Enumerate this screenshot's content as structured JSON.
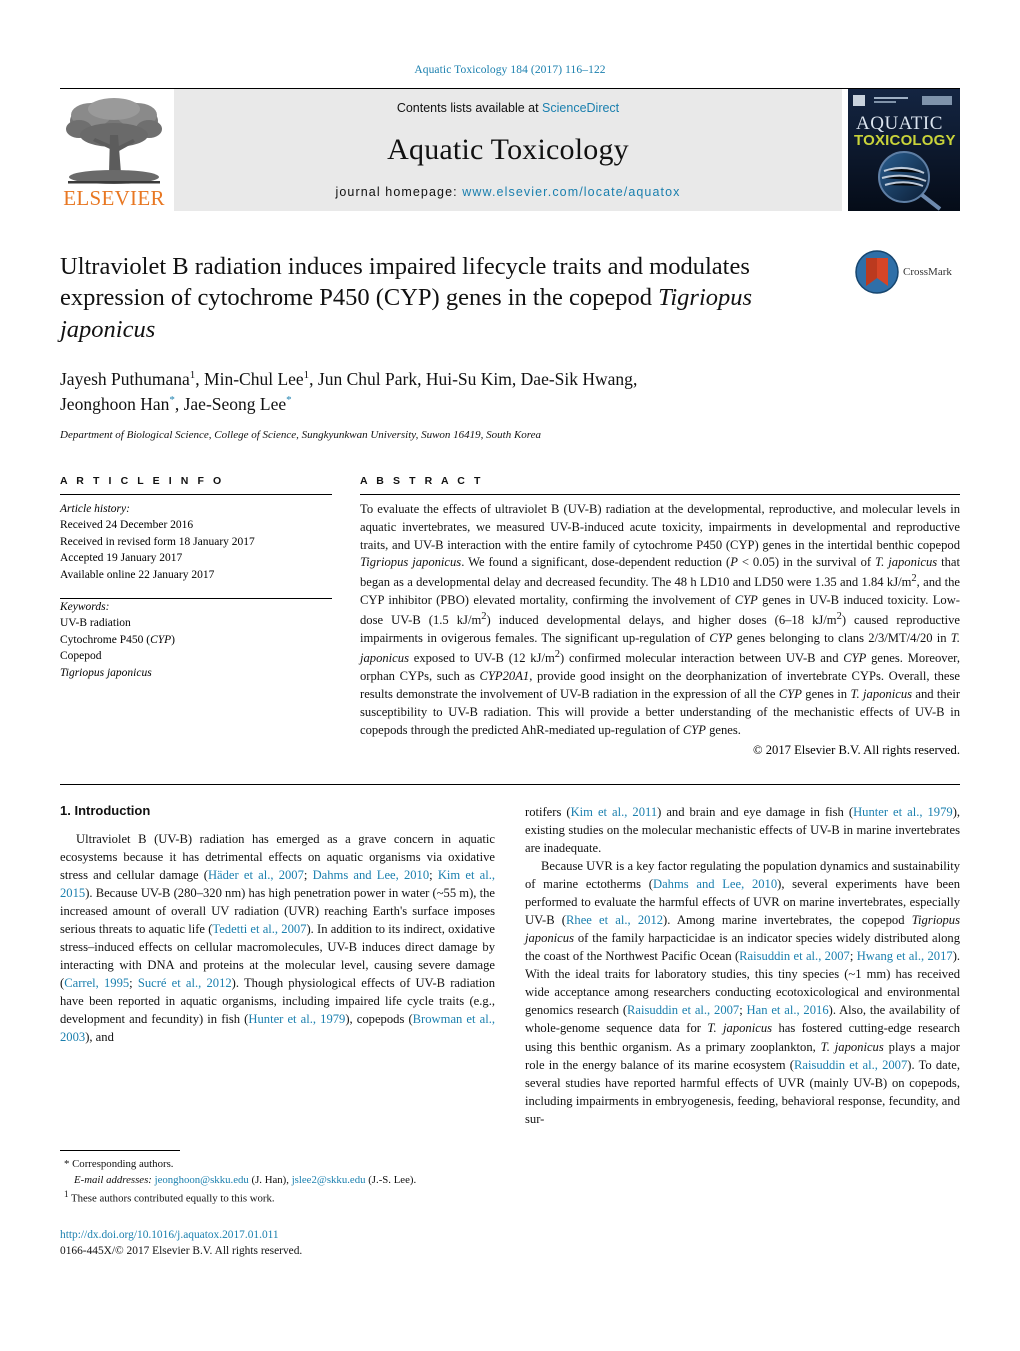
{
  "running_head": "Aquatic Toxicology 184 (2017) 116–122",
  "masthead": {
    "contents_prefix": "Contents lists available at ",
    "sciencedirect": "ScienceDirect",
    "journal_name": "Aquatic Toxicology",
    "homepage_prefix": "journal homepage: ",
    "homepage_url": "www.elsevier.com/locate/aquatox",
    "elsevier_wordmark": "ELSEVIER",
    "cover_line1": "AQUATIC",
    "cover_line2": "TOXICOLOGY",
    "accent_blue": "#1a7fae",
    "elsevier_orange": "#E87722"
  },
  "article": {
    "title_part1": "Ultraviolet B radiation induces impaired lifecycle traits and modulates expression of cytochrome P450 (CYP) genes in the copepod ",
    "title_italic": "Tigriopus japonicus",
    "crossmark_label": "CrossMark",
    "authors": "Jayesh Puthumana, Min-Chul Lee, Jun Chul Park, Hui-Su Kim, Dae-Sik Hwang, Jeonghoon Han, Jae-Seong Lee",
    "affiliation": "Department of Biological Science, College of Science, Sungkyunkwan University, Suwon 16419, South Korea"
  },
  "sections": {
    "article_info_heading": "A R T I C L E   I N F O",
    "abstract_heading": "A B S T R A C T"
  },
  "article_history": {
    "label": "Article history:",
    "lines": [
      "Received 24 December 2016",
      "Received in revised form 18 January 2017",
      "Accepted 19 January 2017",
      "Available online 22 January 2017"
    ]
  },
  "keywords": {
    "label": "Keywords:",
    "items": [
      "UV-B radiation",
      "Cytochrome P450 (CYP)",
      "Copepod",
      "Tigriopus japonicus"
    ]
  },
  "abstract": {
    "text": "To evaluate the effects of ultraviolet B (UV-B) radiation at the developmental, reproductive, and molecular levels in aquatic invertebrates, we measured UV-B-induced acute toxicity, impairments in developmental and reproductive traits, and UV-B interaction with the entire family of cytochrome P450 (CYP) genes in the intertidal benthic copepod Tigriopus japonicus. We found a significant, dose-dependent reduction (P < 0.05) in the survival of T. japonicus that began as a developmental delay and decreased fecundity. The 48 h LD10 and LD50 were 1.35 and 1.84 kJ/m2, and the CYP inhibitor (PBO) elevated mortality, confirming the involvement of CYP genes in UV-B induced toxicity. Low-dose UV-B (1.5 kJ/m2) induced developmental delays, and higher doses (6–18 kJ/m2) caused reproductive impairments in ovigerous females. The significant up-regulation of CYP genes belonging to clans 2/3/MT/4/20 in T. japonicus exposed to UV-B (12 kJ/m2) confirmed molecular interaction between UV-B and CYP genes. Moreover, orphan CYPs, such as CYP20A1, provide good insight on the deorphanization of invertebrate CYPs. Overall, these results demonstrate the involvement of UV-B radiation in the expression of all the CYP genes in T. japonicus and their susceptibility to UV-B radiation. This will provide a better understanding of the mechanistic effects of UV-B in copepods through the predicted AhR-mediated up-regulation of CYP genes.",
    "copyright": "© 2017 Elsevier B.V. All rights reserved."
  },
  "introduction": {
    "heading": "1.  Introduction",
    "left_paragraph_1": "Ultraviolet B (UV-B) radiation has emerged as a grave concern in aquatic ecosystems because it has detrimental effects on aquatic organisms via oxidative stress and cellular damage (Häder et al., 2007; Dahms and Lee, 2010; Kim et al., 2015). Because UV-B (280–320 nm) has high penetration power in water (~55 m), the increased amount of overall UV radiation (UVR) reaching Earth's surface imposes serious threats to aquatic life (Tedetti et al., 2007). In addition to its indirect, oxidative stress–induced effects on cellular macromolecules, UV-B induces direct damage by interacting with DNA and proteins at the molecular level, causing severe damage (Carrel, 1995; Sucré et al., 2012). Though physiological effects of UV-B radiation have been reported in aquatic organisms, including impaired life cycle traits (e.g., development and fecundity) in fish (Hunter et al., 1979), copepods (Browman et al., 2003), and",
    "right_paragraph_1": "rotifers (Kim et al., 2011) and brain and eye damage in fish (Hunter et al., 1979), existing studies on the molecular mechanistic effects of UV-B in marine invertebrates are inadequate.",
    "right_paragraph_2": "Because UVR is a key factor regulating the population dynamics and sustainability of marine ectotherms (Dahms and Lee, 2010), several experiments have been performed to evaluate the harmful effects of UVR on marine invertebrates, especially UV-B (Rhee et al., 2012). Among marine invertebrates, the copepod Tigriopus japonicus of the family harpacticidae is an indicator species widely distributed along the coast of the Northwest Pacific Ocean (Raisuddin et al., 2007; Hwang et al., 2017). With the ideal traits for laboratory studies, this tiny species (~1 mm) has received wide acceptance among researchers conducting ecotoxicological and environmental genomics research (Raisuddin et al., 2007; Han et al., 2016). Also, the availability of whole-genome sequence data for T. japonicus has fostered cutting-edge research using this benthic organism. As a primary zooplankton, T. japonicus plays a major role in the energy balance of its marine ecosystem (Raisuddin et al., 2007). To date, several studies have reported harmful effects of UVR (mainly UV-B) on copepods, including impairments in embryogenesis, feeding, behavioral response, fecundity, and sur-"
  },
  "footnotes": {
    "corresponding": "Corresponding authors.",
    "email_label": "E-mail addresses:",
    "email1": "jeonghoon@skku.edu",
    "email1_owner": "(J. Han),",
    "email2": "jslee2@skku.edu",
    "email2_owner": "(J.-S. Lee).",
    "equal_contrib": "These authors contributed equally to this work."
  },
  "footer": {
    "doi": "http://dx.doi.org/10.1016/j.aquatox.2017.01.011",
    "issn": "0166-445X/© 2017 Elsevier B.V. All rights reserved."
  }
}
